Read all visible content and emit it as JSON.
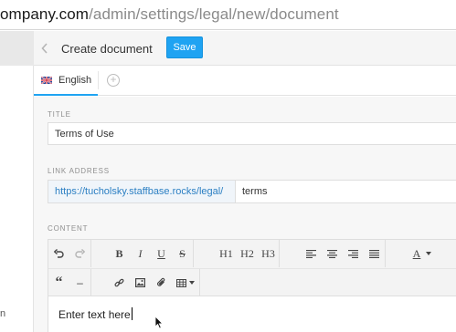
{
  "browser": {
    "url_host": "ompany.com",
    "url_path": "/admin/settings/legal/new/document"
  },
  "sidebar": {
    "fragment": "n"
  },
  "header": {
    "title": "Create document",
    "save_label": "Save"
  },
  "tabs": [
    {
      "label": "English",
      "flag_icon": "uk-flag-icon"
    }
  ],
  "form": {
    "title_label": "TITLE",
    "title_value": "Terms of Use",
    "link_label": "LINK ADDRESS",
    "link_prefix": "https://tucholsky.staffbase.rocks/legal/",
    "link_slug": "terms",
    "content_label": "CONTENT",
    "content_value": "Enter text here"
  },
  "toolbar": {
    "heading_1": "H1",
    "heading_2": "H2",
    "heading_3": "H3",
    "bold": "B",
    "italic": "I",
    "underline": "U",
    "strike": "S",
    "font_color": "A",
    "quote": "“",
    "hr": "–"
  },
  "colors": {
    "accent": "#1fa3f2",
    "link": "#2b7fc3"
  }
}
